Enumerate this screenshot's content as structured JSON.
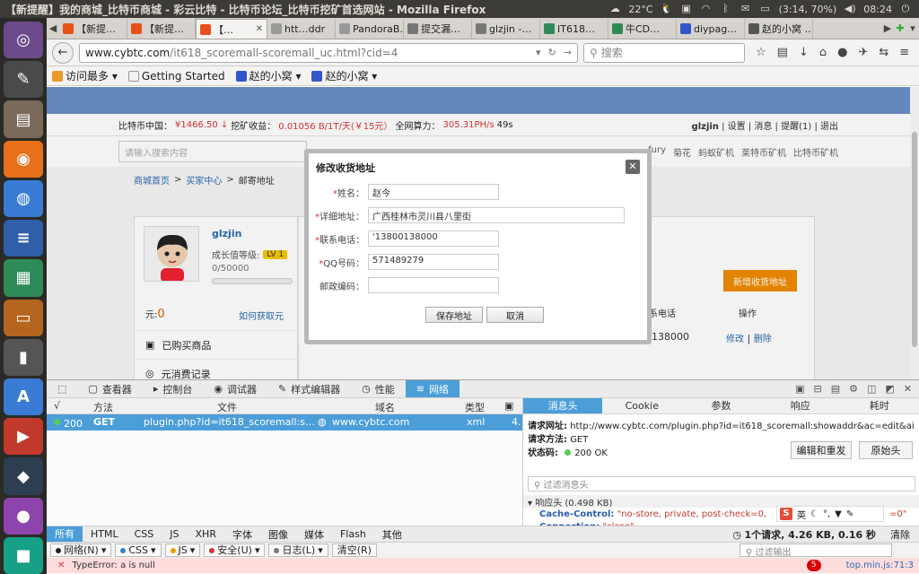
{
  "os": {
    "window_title": "【新提醒】我的商城_比特币商城 - 彩云比特 - 比特币论坛_比特币挖矿首选网站 - Mozilla Firefox",
    "temp": "22°C",
    "battery": "(3:14, 70%)",
    "time": "08:24"
  },
  "browser": {
    "tabs": [
      {
        "label": "【新提…",
        "color": "#e8501a"
      },
      {
        "label": "【新提…",
        "color": "#e8501a"
      },
      {
        "label": "【…",
        "color": "#e8501a",
        "active": true
      },
      {
        "label": "htt…ddr",
        "color": "#999999"
      },
      {
        "label": "PandoraB…",
        "color": "#999999"
      },
      {
        "label": "提交漏…",
        "color": "#777777"
      },
      {
        "label": "glzjin -…",
        "color": "#777777"
      },
      {
        "label": "IT618…",
        "color": "#2e8b57"
      },
      {
        "label": "牛CD…",
        "color": "#2e8b57"
      },
      {
        "label": "diypag…",
        "color": "#3355cc"
      },
      {
        "label": "赵的小窝 …",
        "color": "#555555"
      }
    ],
    "url_host": "www.cybtc.com",
    "url_path": "/it618_scoremall-scoremall_uc.html?cid=4",
    "search_placeholder": "搜索",
    "bookmarks": [
      {
        "label": "访问最多 ▾"
      },
      {
        "label": "Getting Started"
      },
      {
        "label": "赵的小窝 ▾"
      },
      {
        "label": "赵的小窝 ▾"
      }
    ]
  },
  "site": {
    "ticker": {
      "label1": "比特币中国：",
      "price": "¥1466.50 ↓",
      "label2": " 挖矿收益：",
      "yield": "0.01056 B/1T/天(￥15元）",
      "label3": " 全网算力：",
      "hashrate": "305.31PH/s",
      "time": "49s"
    },
    "user_links": {
      "name": "glzjin",
      "rest": " | 设置 | 消息 | 提醒(1) | 退出"
    },
    "search_placeholder": "请输入搜索内容",
    "hot_links": [
      "fury",
      "菊花",
      "蚂蚁矿机",
      "莱特币矿机",
      "比特币矿机"
    ],
    "breadcrumb": [
      "商城首页",
      "买家中心",
      "邮寄地址"
    ],
    "profile": {
      "name": "glzjin",
      "growth_label": "成长值等级:",
      "level": "LV 1",
      "points": "0/50000",
      "balance_label": "元:",
      "balance": "0",
      "how_get": "如何获取元"
    },
    "menu": [
      "已购买商品",
      "元消费记录"
    ],
    "add_button": "新增收货地址",
    "table": {
      "col_phone": "联系电话",
      "col_action": "操作",
      "row_phone": "0138000",
      "edit": "修改",
      "delete": "删除"
    }
  },
  "modal": {
    "title": "修改收货地址",
    "fields": [
      {
        "label": "姓名：",
        "required": true,
        "value": "赵今"
      },
      {
        "label": "详细地址：",
        "required": true,
        "value": "广西桂林市灵川县八里街"
      },
      {
        "label": "联系电话：",
        "required": true,
        "value": "'13800138000"
      },
      {
        "label": "QQ号码：",
        "required": true,
        "value": "571489279"
      },
      {
        "label": "邮政编码：",
        "required": false,
        "value": ""
      }
    ],
    "save": "保存地址",
    "cancel": "取消"
  },
  "devtools": {
    "tabs": [
      "查看器",
      "控制台",
      "调试器",
      "样式编辑器",
      "性能",
      "网络"
    ],
    "columns": [
      "√",
      "方法",
      "文件",
      "域名",
      "类型"
    ],
    "request": {
      "status": "200",
      "method": "GET",
      "file": "plugin.php?id=it618_scoremall:s…",
      "domain": "www.cybtc.com",
      "type": "xml",
      "extra": "4."
    },
    "side_tabs": [
      "消息头",
      "Cookie",
      "参数",
      "响应",
      "耗时"
    ],
    "req_url_label": "请求网址:",
    "req_url": "http://www.cybtc.com/plugin.php?id=it618_scoremall:showaddr&ac=edit&aid=3524&infl…",
    "req_method_label": "请求方法:",
    "req_method": "GET",
    "status_label": "状态码:",
    "status_value": "200 OK",
    "edit_resend": "编辑和重发",
    "raw_headers": "原始头",
    "filter_headers": "过滤消息头",
    "response_header": "▾ 响应头 (0.498 KB)",
    "cache_control_k": "Cache-Control:",
    "cache_control_v": "\"no-store, private, post-check=0,",
    "cache_control_tail": "=0\"",
    "connection_k": "Connection:",
    "connection_v": "\"close\"",
    "ime": "英",
    "filter_tabs": [
      "所有",
      "HTML",
      "CSS",
      "JS",
      "XHR",
      "字体",
      "图像",
      "媒体",
      "Flash",
      "其他"
    ],
    "summary": "1个请求, 4.26 KB, 0.16 秒",
    "clear": "清除",
    "console_buttons": [
      {
        "label": "网络(N)",
        "color": "#222222"
      },
      {
        "label": "CSS",
        "color": "#3a7bd5"
      },
      {
        "label": "JS",
        "color": "#e6a100"
      },
      {
        "label": "安全(U)",
        "color": "#d33333"
      },
      {
        "label": "日志(L)",
        "color": "#777777"
      }
    ],
    "clear_console": "清空(R)",
    "console_filter": "过滤输出",
    "error": "TypeError: a is null",
    "error_count": "5",
    "error_src": "top.min.js:71:3"
  }
}
